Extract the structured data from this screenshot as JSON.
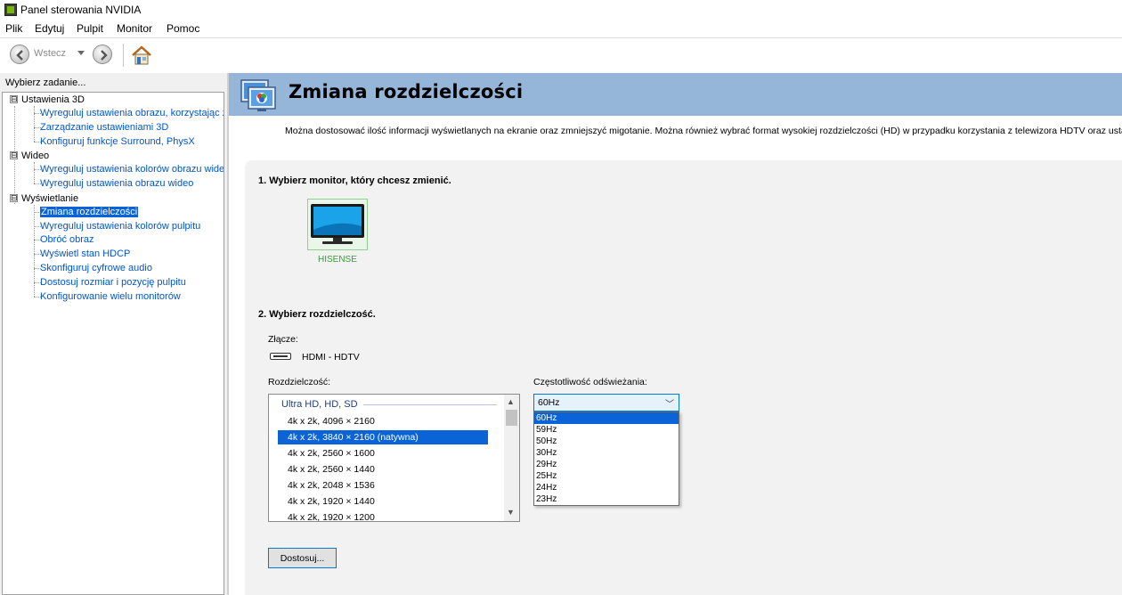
{
  "window": {
    "title": "Panel sterowania NVIDIA",
    "app_icon": "nvidia-icon"
  },
  "menu": {
    "items": [
      "Plik",
      "Edytuj",
      "Pulpit",
      "Monitor",
      "Pomoc"
    ]
  },
  "toolbar": {
    "back_label": "Wstecz",
    "back_icon": "back-arrow-icon",
    "forward_icon": "forward-arrow-icon",
    "home_icon": "home-icon"
  },
  "sidebar": {
    "header": "Wybierz zadanie...",
    "groups": [
      {
        "label": "Ustawienia 3D",
        "toggle": "⊟",
        "items": [
          "Wyreguluj ustawienia obrazu, korzystając z",
          "Zarządzanie ustawieniami 3D",
          "Konfiguruj funkcje Surround, PhysX"
        ]
      },
      {
        "label": "Wideo",
        "toggle": "⊟",
        "items": [
          "Wyreguluj ustawienia kolorów obrazu wideo",
          "Wyreguluj ustawienia obrazu wideo"
        ]
      },
      {
        "label": "Wyświetlanie",
        "toggle": "⊟",
        "items": [
          "Zmiana rozdzielczości",
          "Wyreguluj ustawienia kolorów pulpitu",
          "Obróć obraz",
          "Wyświetl stan HDCP",
          "Skonfiguruj cyfrowe audio",
          "Dostosuj rozmiar i pozycję pulpitu",
          "Konfigurowanie wielu monitorów"
        ]
      }
    ],
    "selected_item": "Zmiana rozdzielczości"
  },
  "page": {
    "title": "Zmiana rozdzielczości",
    "description": "Można dostosować ilość informacji wyświetlanych na ekranie oraz zmniejszyć migotanie. Można również wybrać format wysokiej rozdzielczości (HD) w przypadku korzystania z telewizora HDTV oraz usta",
    "step1": "1. Wybierz monitor, który chcesz zmienić.",
    "monitor_name": "HISENSE",
    "step2": "2. Wybierz rozdzielczość.",
    "connector_label": "Złącze:",
    "connector_value": "HDMI - HDTV",
    "resolution_label": "Rozdzielczość:",
    "resolution_group": "Ultra HD, HD, SD",
    "resolutions": [
      "4k x 2k, 4096 × 2160",
      "4k x 2k, 3840 × 2160 (natywna)",
      "4k x 2k, 2560 × 1600",
      "4k x 2k, 2560 × 1440",
      "4k x 2k, 2048 × 1536",
      "4k x 2k, 1920 × 1440",
      "4k x 2k, 1920 × 1200"
    ],
    "selected_resolution": "4k x 2k, 3840 × 2160 (natywna)",
    "refresh_label": "Częstotliwość odświeżania:",
    "refresh_value": "60Hz",
    "refresh_options": [
      "60Hz",
      "59Hz",
      "50Hz",
      "30Hz",
      "29Hz",
      "25Hz",
      "24Hz",
      "23Hz"
    ],
    "customize_button": "Dostosuj..."
  },
  "colors": {
    "header_band": "#95b6d8",
    "selection": "#0a64d8",
    "monitor_name": "#3a9a3a",
    "link": "#0055cc"
  }
}
